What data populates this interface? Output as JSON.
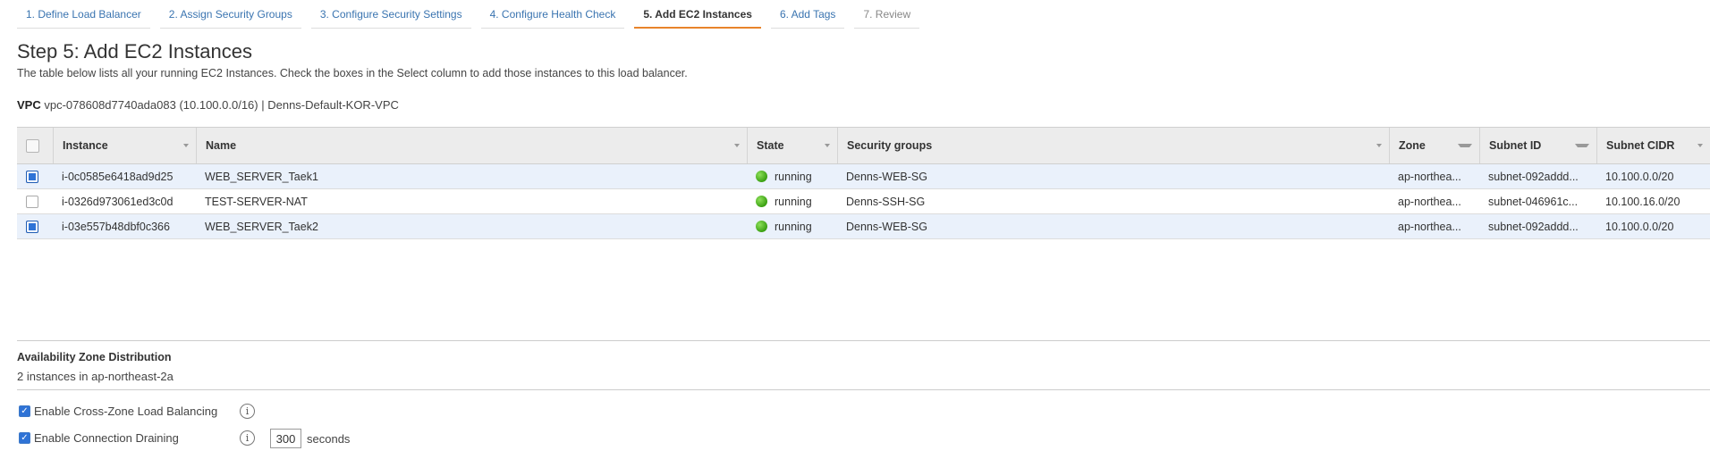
{
  "tabs": [
    {
      "label": "1. Define Load Balancer"
    },
    {
      "label": "2. Assign Security Groups"
    },
    {
      "label": "3. Configure Security Settings"
    },
    {
      "label": "4. Configure Health Check"
    },
    {
      "label": "5. Add EC2 Instances"
    },
    {
      "label": "6. Add Tags"
    },
    {
      "label": "7. Review"
    }
  ],
  "page": {
    "title": "Step 5: Add EC2 Instances",
    "description": "The table below lists all your running EC2 Instances. Check the boxes in the Select column to add those instances to this load balancer."
  },
  "vpc": {
    "label": "VPC",
    "value": "vpc-078608d7740ada083 (10.100.0.0/16) | Denns-Default-KOR-VPC"
  },
  "table": {
    "headers": {
      "instance": "Instance",
      "name": "Name",
      "state": "State",
      "security_groups": "Security groups",
      "zone": "Zone",
      "subnet_id": "Subnet ID",
      "subnet_cidr": "Subnet CIDR"
    },
    "rows": [
      {
        "selected": true,
        "instance": "i-0c0585e6418ad9d25",
        "name": "WEB_SERVER_Taek1",
        "state": "running",
        "security_groups": "Denns-WEB-SG",
        "zone": "ap-northea...",
        "subnet_id": "subnet-092addd...",
        "subnet_cidr": "10.100.0.0/20"
      },
      {
        "selected": false,
        "instance": "i-0326d973061ed3c0d",
        "name": "TEST-SERVER-NAT",
        "state": "running",
        "security_groups": "Denns-SSH-SG",
        "zone": "ap-northea...",
        "subnet_id": "subnet-046961c...",
        "subnet_cidr": "10.100.16.0/20"
      },
      {
        "selected": true,
        "instance": "i-03e557b48dbf0c366",
        "name": "WEB_SERVER_Taek2",
        "state": "running",
        "security_groups": "Denns-WEB-SG",
        "zone": "ap-northea...",
        "subnet_id": "subnet-092addd...",
        "subnet_cidr": "10.100.0.0/20"
      }
    ]
  },
  "availability": {
    "title": "Availability Zone Distribution",
    "text": "2 instances in ap-northeast-2a"
  },
  "options": {
    "cross_zone_label": "Enable Cross-Zone Load Balancing",
    "cross_zone_checked": true,
    "draining_label": "Enable Connection Draining",
    "draining_checked": true,
    "draining_timeout": "300",
    "seconds_label": "seconds"
  },
  "colors": {
    "accent": "#e8842b",
    "link": "#3a74b0",
    "selected_row": "#eaf1fb",
    "running": "#3aa012"
  }
}
